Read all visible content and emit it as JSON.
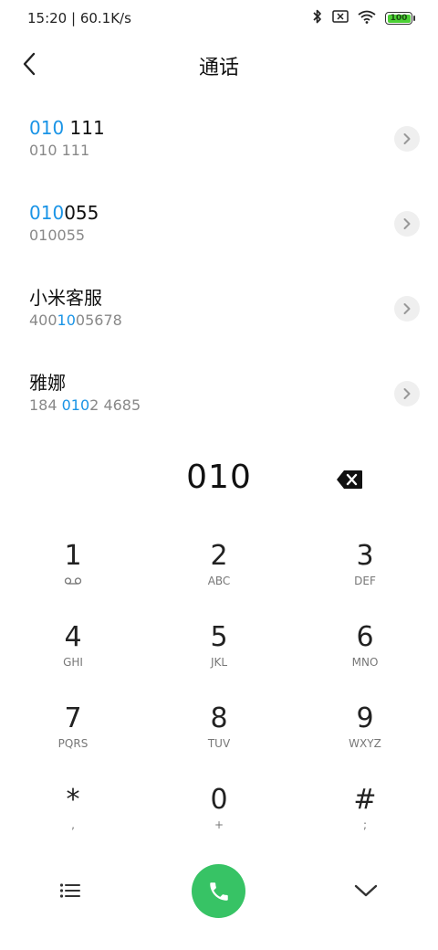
{
  "status_bar": {
    "time_speed": "15:20 | 60.1K/s",
    "battery": "100",
    "battery_level": 1.0,
    "icons": [
      "bluetooth-icon",
      "sim-disabled-icon",
      "wifi-icon",
      "battery-icon"
    ]
  },
  "header": {
    "title": "通话",
    "back_icon": "back-arrow-icon"
  },
  "results": [
    {
      "name_prefix": "",
      "name_match": "010",
      "name_suffix": " 111",
      "num_prefix": "010 111",
      "num_match": "",
      "num_suffix": ""
    },
    {
      "name_prefix": "",
      "name_match": "010",
      "name_suffix": "055",
      "num_prefix": "010055",
      "num_match": "",
      "num_suffix": ""
    },
    {
      "name_prefix": "小米客服",
      "name_match": "",
      "name_suffix": "",
      "num_prefix": "400",
      "num_match": "10",
      "num_suffix": "05678"
    },
    {
      "name_prefix": "雅娜",
      "name_match": "",
      "name_suffix": "",
      "num_prefix": "184 ",
      "num_match": "010",
      "num_suffix": "2 4685"
    }
  ],
  "dial": {
    "value": "010",
    "backspace_icon": "backspace-icon"
  },
  "keypad": [
    {
      "digit": "1",
      "letters": "",
      "icon": "voicemail-icon"
    },
    {
      "digit": "2",
      "letters": "ABC"
    },
    {
      "digit": "3",
      "letters": "DEF"
    },
    {
      "digit": "4",
      "letters": "GHI"
    },
    {
      "digit": "5",
      "letters": "JKL"
    },
    {
      "digit": "6",
      "letters": "MNO"
    },
    {
      "digit": "7",
      "letters": "PQRS"
    },
    {
      "digit": "8",
      "letters": "TUV"
    },
    {
      "digit": "9",
      "letters": "WXYZ"
    },
    {
      "digit": "*",
      "letters": ","
    },
    {
      "digit": "0",
      "letters": "+"
    },
    {
      "digit": "#",
      "letters": ";"
    }
  ],
  "bottom_bar": {
    "menu_icon": "menu-list-icon",
    "call_icon": "phone-icon",
    "collapse_icon": "chevron-down-icon"
  },
  "colors": {
    "highlight": "#1a94e6",
    "call_button": "#37c365",
    "battery_fill": "#4cd035"
  }
}
